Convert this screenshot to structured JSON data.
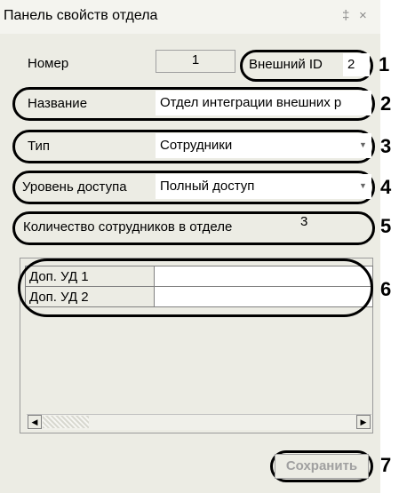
{
  "window": {
    "title": "Панель свойств отдела",
    "pin_glyph": "‡",
    "close_glyph": "×"
  },
  "form": {
    "number_label": "Номер",
    "number_value": "1",
    "external_id_label": "Внешний ID",
    "external_id_value": "2",
    "name_label": "Название",
    "name_value": "Отдел интеграции внешних р",
    "type_label": "Тип",
    "type_value": "Сотрудники",
    "access_label": "Уровень доступа",
    "access_value": "Полный доступ",
    "employee_count_label": "Количество сотрудников в отделе",
    "employee_count_value": "3"
  },
  "grid": {
    "rows": [
      {
        "label": "Доп. УД 1",
        "value": ""
      },
      {
        "label": "Доп. УД 2",
        "value": ""
      }
    ]
  },
  "buttons": {
    "save_label": "Сохранить"
  },
  "callouts": [
    "1",
    "2",
    "3",
    "4",
    "5",
    "6",
    "7"
  ]
}
